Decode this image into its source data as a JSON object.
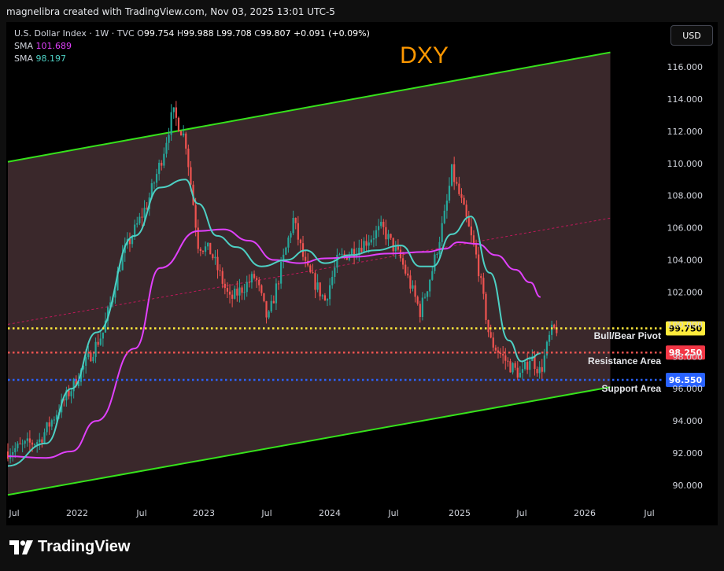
{
  "attribution": "magnelibra created with TradingView.com, Nov 03, 2025 13:01 UTC-5",
  "legend": {
    "symbol_line": "U.S. Dollar Index · 1W · TVC",
    "ohlc": {
      "o_label": "O",
      "o": "99.754",
      "h_label": "H",
      "h": "99.988",
      "l_label": "L",
      "l": "99.708",
      "c_label": "C",
      "c": "99.807",
      "change": "+0.091 (+0.09%)"
    },
    "sma1_label": "SMA",
    "sma1_value": "101.689",
    "sma2_label": "SMA",
    "sma2_value": "98.197"
  },
  "currency_button": "USD",
  "brand": "TradingView",
  "colors": {
    "bull": "#26a69a",
    "bear": "#ef5350",
    "sma_slow": "#e040fb",
    "sma_fast": "#4dd0c4",
    "channel": "#36e21b",
    "pivot": "#ffeb3b",
    "resistance": "#ef5350",
    "support": "#2962ff",
    "title": "#ff9800"
  },
  "chart_data": {
    "type": "line",
    "title": "DXY",
    "x_ticks": [
      "Jul",
      "2022",
      "Jul",
      "2023",
      "Jul",
      "2024",
      "Jul",
      "2025",
      "Jul",
      "2026",
      "Jul"
    ],
    "y_ticks": [
      "116.000",
      "114.000",
      "112.000",
      "110.000",
      "108.000",
      "106.000",
      "104.000",
      "102.000",
      "100.000",
      "98.000",
      "96.000",
      "94.000",
      "92.000",
      "90.000"
    ],
    "ylim": [
      89.2,
      118.2
    ],
    "price_path": {
      "name": "U.S. Dollar Index",
      "x": [
        2021.5,
        2021.75,
        2022.0,
        2022.25,
        2022.4,
        2022.6,
        2022.72,
        2022.8,
        2022.9,
        2023.0,
        2023.1,
        2023.25,
        2023.45,
        2023.55,
        2023.75,
        2023.85,
        2024.0,
        2024.1,
        2024.3,
        2024.45,
        2024.6,
        2024.75,
        2024.85,
        2024.95,
        2025.0,
        2025.08,
        2025.2,
        2025.3,
        2025.45,
        2025.55,
        2025.62,
        2025.7,
        2025.78,
        2025.84
      ],
      "y": [
        92.1,
        92.8,
        96.0,
        99.5,
        104.2,
        107.5,
        110.5,
        113.2,
        111.5,
        105.0,
        104.5,
        101.5,
        103.0,
        100.2,
        106.5,
        103.5,
        101.5,
        104.0,
        105.0,
        106.0,
        104.0,
        100.8,
        103.5,
        107.0,
        109.5,
        107.5,
        104.0,
        99.0,
        97.5,
        96.8,
        98.0,
        97.0,
        99.5,
        99.8
      ]
    },
    "series": [
      {
        "name": "SMA 101.689",
        "x": [
          2021.5,
          2021.8,
          2022.0,
          2022.2,
          2022.5,
          2022.7,
          2023.0,
          2023.2,
          2023.4,
          2023.6,
          2023.8,
          2024.0,
          2024.25,
          2024.5,
          2024.8,
          2024.95,
          2025.05,
          2025.2,
          2025.35,
          2025.5,
          2025.62,
          2025.7
        ],
        "y": [
          91.8,
          91.7,
          92.1,
          94.0,
          98.5,
          103.5,
          105.8,
          105.9,
          105.2,
          104.0,
          103.8,
          104.1,
          104.2,
          104.4,
          104.5,
          104.7,
          105.1,
          105.0,
          104.3,
          103.4,
          102.6,
          101.7
        ]
      },
      {
        "name": "SMA 98.197",
        "x": [
          2021.5,
          2021.8,
          2022.0,
          2022.2,
          2022.5,
          2022.7,
          2022.9,
          2023.0,
          2023.15,
          2023.3,
          2023.5,
          2023.7,
          2023.85,
          2024.0,
          2024.2,
          2024.4,
          2024.6,
          2024.75,
          2024.85,
          2025.0,
          2025.15,
          2025.3,
          2025.45,
          2025.55,
          2025.62,
          2025.7
        ],
        "y": [
          91.2,
          92.6,
          96.0,
          99.5,
          105.5,
          108.5,
          109.0,
          107.5,
          105.5,
          104.8,
          103.6,
          104.0,
          104.6,
          103.8,
          104.3,
          104.6,
          104.9,
          103.6,
          103.6,
          105.6,
          106.7,
          103.2,
          99.0,
          97.7,
          97.9,
          98.2
        ]
      }
    ],
    "channel": {
      "upper": {
        "x": [
          2021.5,
          2026.25
        ],
        "y": [
          110.1,
          116.9
        ]
      },
      "lower": {
        "x": [
          2021.5,
          2026.25
        ],
        "y": [
          89.4,
          96.1
        ]
      },
      "midline": {
        "x": [
          2021.5,
          2026.25
        ],
        "y": [
          100.0,
          106.6
        ]
      }
    },
    "levels": [
      {
        "name": "Bull/Bear Pivot",
        "value": "99.750",
        "y": 99.75
      },
      {
        "name": "Resistance Area",
        "value": "98.250",
        "y": 98.25
      },
      {
        "name": "Support Area",
        "value": "96.550",
        "y": 96.55
      }
    ],
    "grid": false
  }
}
